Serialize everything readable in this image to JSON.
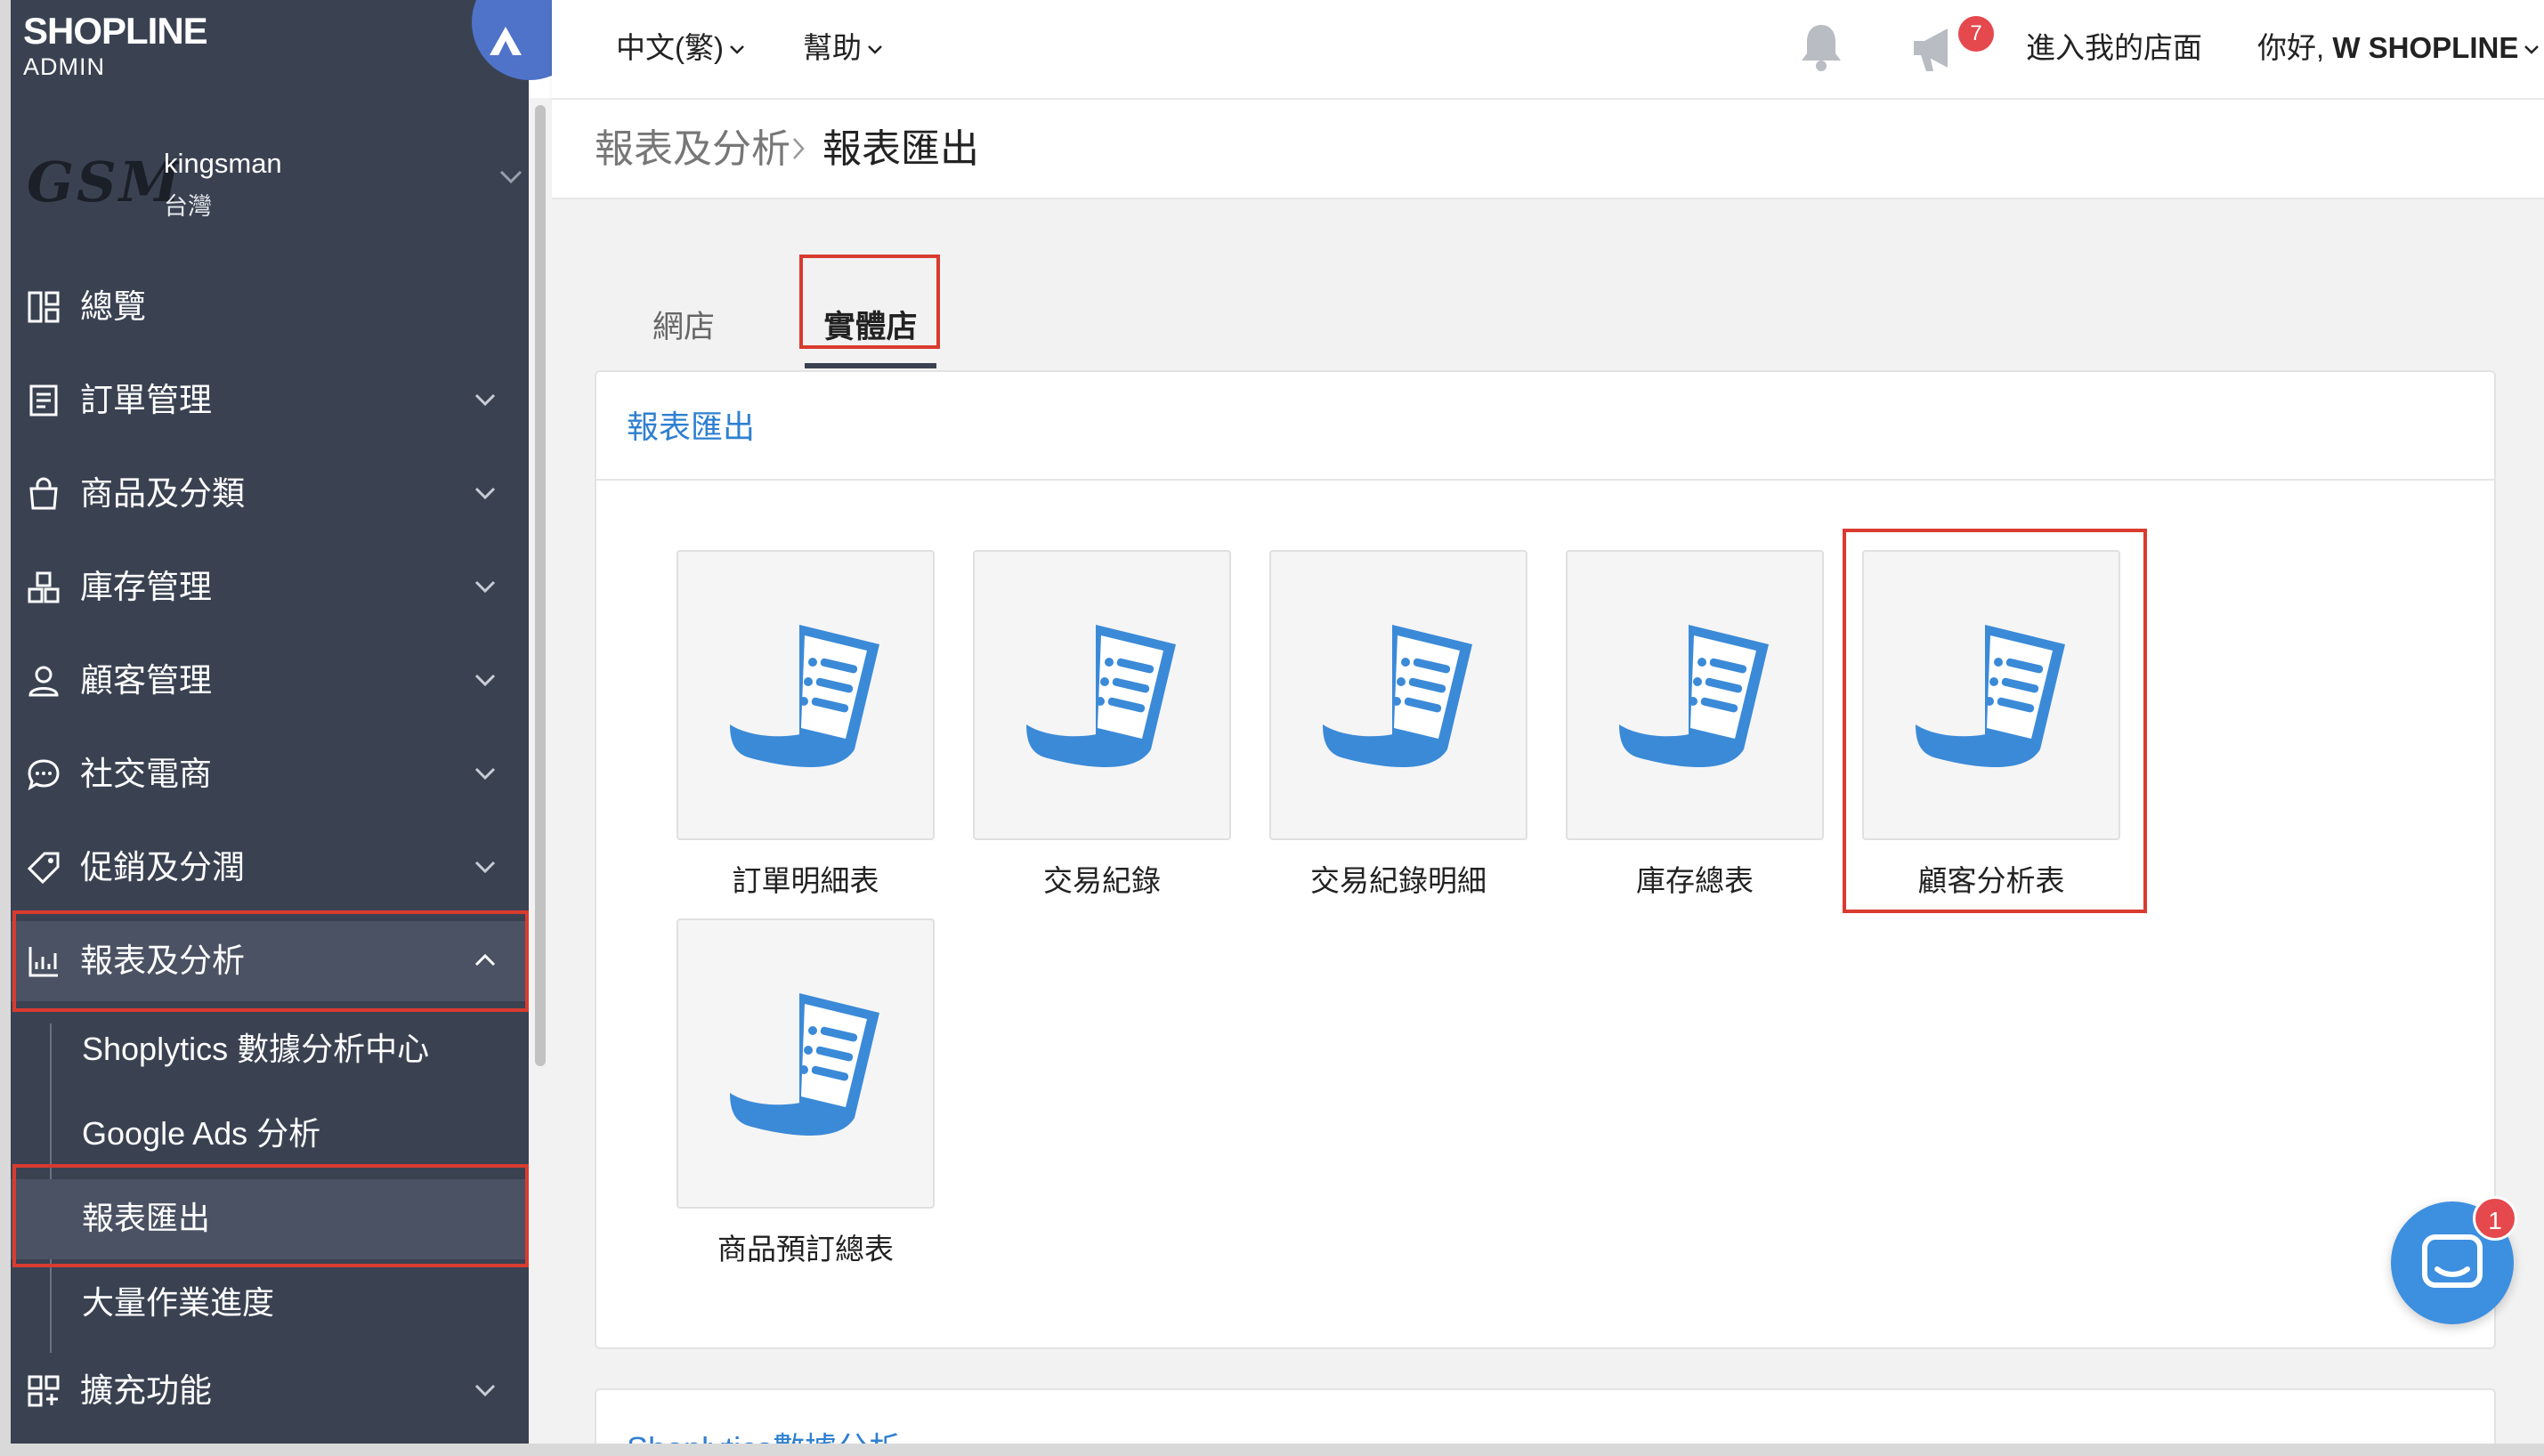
{
  "brand": {
    "logo_main": "SHOPLINE",
    "logo_sub": "ADMIN"
  },
  "store": {
    "logo_text": "GSM",
    "name": "kingsman",
    "region": "台灣"
  },
  "sidebar": {
    "items": [
      {
        "label": "總覽",
        "icon": "dashboard-icon"
      },
      {
        "label": "訂單管理",
        "icon": "order-icon"
      },
      {
        "label": "商品及分類",
        "icon": "shopping-bag-icon"
      },
      {
        "label": "庫存管理",
        "icon": "inventory-icon"
      },
      {
        "label": "顧客管理",
        "icon": "customer-icon"
      },
      {
        "label": "社交電商",
        "icon": "chat-bubble-icon"
      },
      {
        "label": "促銷及分潤",
        "icon": "tag-icon"
      },
      {
        "label": "報表及分析",
        "icon": "chart-icon"
      },
      {
        "label": "擴充功能",
        "icon": "apps-icon"
      }
    ],
    "subitems": [
      {
        "label": "Shoplytics 數據分析中心"
      },
      {
        "label": "Google Ads 分析"
      },
      {
        "label": "報表匯出"
      },
      {
        "label": "大量作業進度"
      }
    ]
  },
  "topbar": {
    "language": "中文(繁)",
    "help": "幫助",
    "notification_count": "7",
    "enter_store": "進入我的店面",
    "greeting": "你好, ",
    "username": "W SHOPLINE"
  },
  "breadcrumb": {
    "parent": "報表及分析",
    "current": "報表匯出"
  },
  "tabs": [
    {
      "label": "網店"
    },
    {
      "label": "實體店"
    }
  ],
  "section": {
    "title": "報表匯出",
    "reports": [
      {
        "label": "訂單明細表"
      },
      {
        "label": "交易紀錄"
      },
      {
        "label": "交易紀錄明細"
      },
      {
        "label": "庫存總表"
      },
      {
        "label": "顧客分析表"
      },
      {
        "label": "商品預訂總表"
      }
    ]
  },
  "section2": {
    "title": "Shoplytics數據分析"
  },
  "chat": {
    "badge_count": "1"
  },
  "colors": {
    "sidebar_bg": "#3a4252",
    "accent_blue": "#2f80d1",
    "highlight_red": "#d93b2f",
    "badge_red": "#e5484d"
  }
}
